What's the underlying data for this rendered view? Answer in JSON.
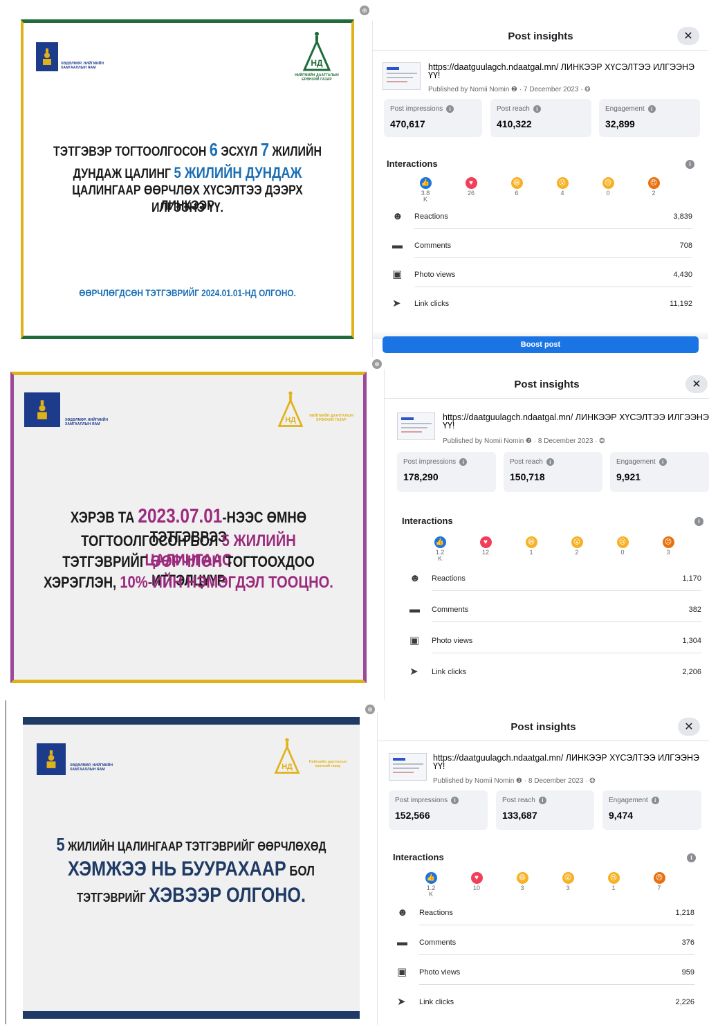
{
  "posters": [
    {
      "ministry": "ХӨДӨЛМӨР, НИЙГМИЙН ХАМГААЛЛЫН ЯАМ",
      "agency": "НИЙГМИЙН ДААТГАЛЫН ЕРӨНХИЙ ГАЗАР",
      "lines": [
        [
          "ТЭТГЭВЭР ТОГТООЛГОСОН ",
          "6",
          " ЭСХҮЛ ",
          "7",
          " ЖИЛИЙН"
        ],
        [
          "ДУНДАЖ ЦАЛИНГ ",
          "5 ЖИЛИЙН ДУНДАЖ"
        ],
        [
          "ЦАЛИНГААР ӨӨРЧЛӨХ ХҮСЭЛТЭЭ ДЭЭРХ ЛИНКЭЭР"
        ],
        [
          "ИЛГЭЭНЭ ҮҮ."
        ]
      ],
      "footer": "ӨӨРЧЛӨГДСӨН ТЭТГЭВРИЙГ 2024.01.01-НД ОЛГОНО."
    },
    {
      "ministry": "ХӨДӨЛМӨР, НИЙГМИЙН ХАМГААЛЛЫН ЯАМ",
      "agency": "НИЙГМИЙН ДААТГАЛЫН ЕРӨНХИЙ ГАЗАР",
      "lines": [
        [
          "ХЭРЭВ ТА ",
          "2023.07.01",
          "-НЭЭС ӨМНӨ ТЭТГЭВРЭЭ"
        ],
        [
          "ТОГТООЛГОСОН БОЛ ",
          "5 ЖИЛИЙН ЦАЛИНГААС"
        ],
        [
          "ТЭТГЭВРИЙГ ",
          "ӨӨРЧЛӨН",
          " ТОГТООХДОО ИТГЭЛЦҮҮР"
        ],
        [
          "ХЭРЭГЛЭН, ",
          "10%-ИЙН НЭМЭГДЭЛ ТООЦНО."
        ]
      ]
    },
    {
      "ministry": "ХӨДӨЛМӨР, НИЙГМИЙН ХАМГААЛЛЫН ЯАМ",
      "agency": "Нийгмийн даатгалын ерөнхий газар",
      "lines": [
        [
          "5",
          " ЖИЛИЙН ЦАЛИНГААР ТЭТГЭВРИЙГ ӨӨРЧЛӨХӨД"
        ],
        [
          "ХЭМЖЭЭ НЬ БУУРАХААР",
          " БОЛ"
        ],
        [
          "ТЭТГЭВРИЙГ ",
          "ХЭВЭЭР ОЛГОНО."
        ]
      ]
    }
  ],
  "insights": [
    {
      "title": "Post insights",
      "url": "https://daatguulagch.ndaatgal.mn/ ЛИНКЭЭР ХҮСЭЛТЭЭ ИЛГЭЭНЭ ҮҮ!",
      "published": "Published by Nomii Nomin ❷ · 7 December 2023 · ❂",
      "cards": [
        {
          "label": "Post impressions",
          "value": "470,617"
        },
        {
          "label": "Post reach",
          "value": "410,322"
        },
        {
          "label": "Engagement",
          "value": "32,899"
        }
      ],
      "interactions_label": "Interactions",
      "reactions": [
        {
          "icon": "like-icon",
          "count": "3.8 K",
          "color": "#1b74e4",
          "glyph": "👍"
        },
        {
          "icon": "love-icon",
          "count": "26",
          "color": "#f33e58",
          "glyph": "♥"
        },
        {
          "icon": "haha-icon",
          "count": "6",
          "color": "#f7b125",
          "glyph": "😄"
        },
        {
          "icon": "wow-icon",
          "count": "4",
          "color": "#f7b125",
          "glyph": "😮"
        },
        {
          "icon": "sad-icon",
          "count": "0",
          "color": "#f7b125",
          "glyph": "😢"
        },
        {
          "icon": "angry-icon",
          "count": "2",
          "color": "#e9710f",
          "glyph": "😠"
        }
      ],
      "rows": [
        {
          "icon": "reactions-icon",
          "glyph": "☻",
          "label": "Reactions",
          "value": "3,839"
        },
        {
          "icon": "comments-icon",
          "glyph": "▬",
          "label": "Comments",
          "value": "708"
        },
        {
          "icon": "photo-views-icon",
          "glyph": "▣",
          "label": "Photo views",
          "value": "4,430"
        },
        {
          "icon": "link-clicks-icon",
          "glyph": "➤",
          "label": "Link clicks",
          "value": "11,192"
        }
      ],
      "boost": "Boost post"
    },
    {
      "title": "Post insights",
      "url": "https://daatguulagch.ndaatgal.mn/ ЛИНКЭЭР ХҮСЭЛТЭЭ ИЛГЭЭНЭ ҮҮ!",
      "published": "Published by Nomii Nomin ❷ · 8 December 2023 · ❂",
      "cards": [
        {
          "label": "Post impressions",
          "value": "178,290"
        },
        {
          "label": "Post reach",
          "value": "150,718"
        },
        {
          "label": "Engagement",
          "value": "9,921"
        }
      ],
      "interactions_label": "Interactions",
      "reactions": [
        {
          "icon": "like-icon",
          "count": "1.2 K",
          "color": "#1b74e4",
          "glyph": "👍"
        },
        {
          "icon": "love-icon",
          "count": "12",
          "color": "#f33e58",
          "glyph": "♥"
        },
        {
          "icon": "haha-icon",
          "count": "1",
          "color": "#f7b125",
          "glyph": "😄"
        },
        {
          "icon": "wow-icon",
          "count": "2",
          "color": "#f7b125",
          "glyph": "😮"
        },
        {
          "icon": "sad-icon",
          "count": "0",
          "color": "#f7b125",
          "glyph": "😢"
        },
        {
          "icon": "angry-icon",
          "count": "3",
          "color": "#e9710f",
          "glyph": "😠"
        }
      ],
      "rows": [
        {
          "icon": "reactions-icon",
          "glyph": "☻",
          "label": "Reactions",
          "value": "1,170"
        },
        {
          "icon": "comments-icon",
          "glyph": "▬",
          "label": "Comments",
          "value": "382"
        },
        {
          "icon": "photo-views-icon",
          "glyph": "▣",
          "label": "Photo views",
          "value": "1,304"
        },
        {
          "icon": "link-clicks-icon",
          "glyph": "➤",
          "label": "Link clicks",
          "value": "2,206"
        }
      ]
    },
    {
      "title": "Post insights",
      "url": "https://daatguulagch.ndaatgal.mn/ ЛИНКЭЭР ХҮСЭЛТЭЭ ИЛГЭЭНЭ ҮҮ!",
      "published": "Published by Nomii Nomin ❷ · 8 December 2023 · ❂",
      "cards": [
        {
          "label": "Post impressions",
          "value": "152,566"
        },
        {
          "label": "Post reach",
          "value": "133,687"
        },
        {
          "label": "Engagement",
          "value": "9,474"
        }
      ],
      "interactions_label": "Interactions",
      "reactions": [
        {
          "icon": "like-icon",
          "count": "1.2 K",
          "color": "#1b74e4",
          "glyph": "👍"
        },
        {
          "icon": "love-icon",
          "count": "10",
          "color": "#f33e58",
          "glyph": "♥"
        },
        {
          "icon": "haha-icon",
          "count": "3",
          "color": "#f7b125",
          "glyph": "😄"
        },
        {
          "icon": "wow-icon",
          "count": "3",
          "color": "#f7b125",
          "glyph": "😮"
        },
        {
          "icon": "sad-icon",
          "count": "1",
          "color": "#f7b125",
          "glyph": "😢"
        },
        {
          "icon": "angry-icon",
          "count": "7",
          "color": "#e9710f",
          "glyph": "😠"
        }
      ],
      "rows": [
        {
          "icon": "reactions-icon",
          "glyph": "☻",
          "label": "Reactions",
          "value": "1,218"
        },
        {
          "icon": "comments-icon",
          "glyph": "▬",
          "label": "Comments",
          "value": "376"
        },
        {
          "icon": "photo-views-icon",
          "glyph": "▣",
          "label": "Photo views",
          "value": "959"
        },
        {
          "icon": "link-clicks-icon",
          "glyph": "➤",
          "label": "Link clicks",
          "value": "2,226"
        }
      ]
    }
  ],
  "colors": {
    "accent_blue": "#1b74e4",
    "poster1_blue": "#1a6fb5",
    "poster2_purple": "#9b2b7c",
    "poster3_navy": "#1f3a64",
    "border_green": "#1f6b3a",
    "border_gold": "#e0b21a",
    "border_purple": "#9b4a9a"
  }
}
